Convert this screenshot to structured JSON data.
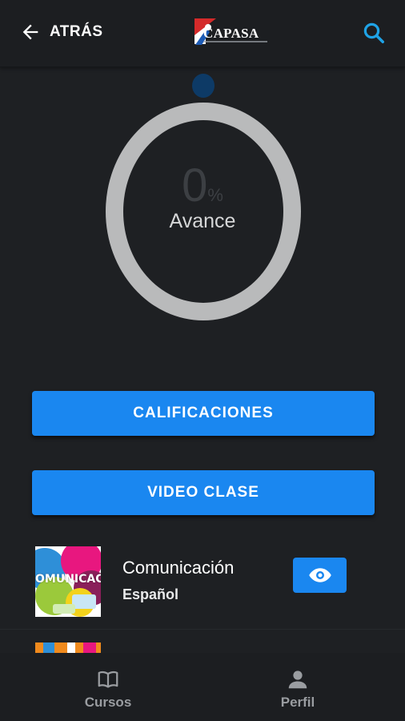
{
  "header": {
    "back_label": "ATRÁS",
    "logo_text": "CAPASA",
    "icons": {
      "back": "arrow-left-icon",
      "search": "search-icon"
    }
  },
  "progress": {
    "value": "0",
    "unit": "%",
    "label": "Avance"
  },
  "buttons": {
    "calificaciones": "CALIFICACIONES",
    "video_clase": "VIDEO CLASE"
  },
  "courses": [
    {
      "title": "Comunicación",
      "subtitle": "Español",
      "thumb_text": "OMUNICACIÓ",
      "action_icon": "eye-icon"
    }
  ],
  "bottom_nav": {
    "items": [
      {
        "label": "Cursos",
        "icon": "book-icon"
      },
      {
        "label": "Perfil",
        "icon": "person-icon"
      }
    ]
  },
  "colors": {
    "background": "#1e2023",
    "accent": "#1a87f0",
    "search_icon": "#1fa3e6",
    "ring": "#b9babb",
    "nav_text": "#9a9da1"
  }
}
